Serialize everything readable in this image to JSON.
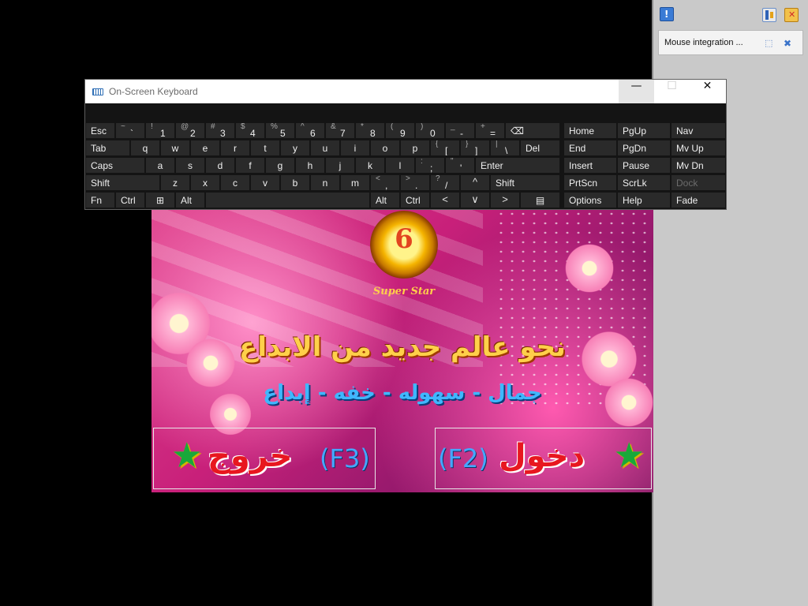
{
  "right_panel": {
    "notification": "Mouse integration ..."
  },
  "osk": {
    "title": "On-Screen Keyboard",
    "min_glyph": "—",
    "max_glyph": "☐",
    "close_glyph": "✕",
    "keys": {
      "esc": "Esc",
      "tilde": {
        "sec": "~",
        "pri": "`"
      },
      "n1": {
        "sec": "!",
        "pri": "1"
      },
      "n2": {
        "sec": "@",
        "pri": "2"
      },
      "n3": {
        "sec": "#",
        "pri": "3"
      },
      "n4": {
        "sec": "$",
        "pri": "4"
      },
      "n5": {
        "sec": "%",
        "pri": "5"
      },
      "n6": {
        "sec": "^",
        "pri": "6"
      },
      "n7": {
        "sec": "&",
        "pri": "7"
      },
      "n8": {
        "sec": "*",
        "pri": "8"
      },
      "n9": {
        "sec": "(",
        "pri": "9"
      },
      "n0": {
        "sec": ")",
        "pri": "0"
      },
      "minus": {
        "sec": "_",
        "pri": "-"
      },
      "plus": {
        "sec": "+",
        "pri": "="
      },
      "bksp": "⌫",
      "home": "Home",
      "pgup": "PgUp",
      "nav": "Nav",
      "tab": "Tab",
      "q": "q",
      "w": "w",
      "e": "e",
      "r": "r",
      "t": "t",
      "y": "y",
      "u": "u",
      "i": "i",
      "o": "o",
      "p": "p",
      "lbr": {
        "sec": "{",
        "pri": "["
      },
      "rbr": {
        "sec": "}",
        "pri": "]"
      },
      "bsl": {
        "sec": "|",
        "pri": "\\"
      },
      "del": "Del",
      "end": "End",
      "pgdn": "PgDn",
      "mvup": "Mv Up",
      "caps": "Caps",
      "a": "a",
      "s": "s",
      "d": "d",
      "f": "f",
      "g": "g",
      "h": "h",
      "j": "j",
      "k": "k",
      "l": "l",
      "semi": {
        "sec": ":",
        "pri": ";"
      },
      "quot": {
        "sec": "\"",
        "pri": "'"
      },
      "enter": "Enter",
      "insert": "Insert",
      "pause": "Pause",
      "mvdn": "Mv Dn",
      "lshift": "Shift",
      "z": "z",
      "x": "x",
      "c": "c",
      "v": "v",
      "b": "b",
      "n": "n",
      "m": "m",
      "comma": {
        "sec": "<",
        "pri": ","
      },
      "period": {
        "sec": ">",
        "pri": "."
      },
      "slash": {
        "sec": "?",
        "pri": "/"
      },
      "up": "^",
      "rshift": "Shift",
      "prtscn": "PrtScn",
      "scrlk": "ScrLk",
      "dock": "Dock",
      "fn": "Fn",
      "lctrl": "Ctrl",
      "win": "⊞",
      "lalt": "Alt",
      "ralt": "Alt",
      "rctrl": "Ctrl",
      "left": "<",
      "down": "∨",
      "right": ">",
      "menu": "▤",
      "options": "Options",
      "help": "Help",
      "fade": "Fade"
    }
  },
  "game": {
    "emblem_number": "6",
    "emblem_caption": "Super Star",
    "slogan": "نحو عالم جديد من الابداع",
    "tagline": "جمال - سهوله - خفه - إبداع",
    "exit_button": {
      "word": "خروج",
      "key": "(F3)"
    },
    "enter_button": {
      "word": "دخول",
      "key": "(F2)"
    }
  }
}
